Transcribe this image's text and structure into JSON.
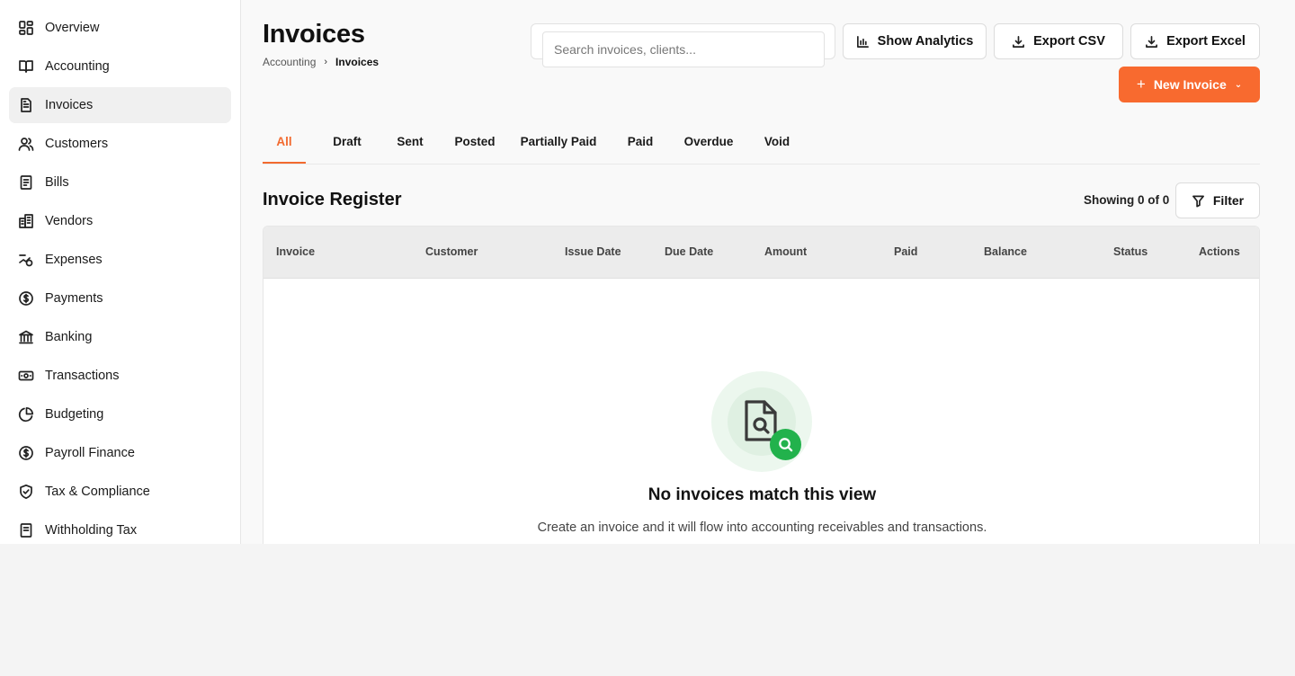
{
  "sidebar": {
    "items": [
      {
        "label": "Overview",
        "icon": "overview-icon"
      },
      {
        "label": "Accounting",
        "icon": "book-icon"
      },
      {
        "label": "Invoices",
        "icon": "invoice-icon",
        "active": true
      },
      {
        "label": "Customers",
        "icon": "users-icon"
      },
      {
        "label": "Bills",
        "icon": "bill-icon"
      },
      {
        "label": "Vendors",
        "icon": "building-icon"
      },
      {
        "label": "Expenses",
        "icon": "expense-icon"
      },
      {
        "label": "Payments",
        "icon": "dollar-icon"
      },
      {
        "label": "Banking",
        "icon": "bank-icon"
      },
      {
        "label": "Transactions",
        "icon": "cash-icon"
      },
      {
        "label": "Budgeting",
        "icon": "pie-icon"
      },
      {
        "label": "Payroll Finance",
        "icon": "dollar-icon"
      },
      {
        "label": "Tax & Compliance",
        "icon": "shield-icon"
      },
      {
        "label": "Withholding Tax",
        "icon": "receipt-icon"
      }
    ]
  },
  "header": {
    "title": "Invoices",
    "breadcrumb": {
      "parent": "Accounting",
      "current": "Invoices"
    },
    "search": {
      "placeholder": "Search invoices, clients...",
      "value": ""
    },
    "actions": {
      "show_analytics": "Show Analytics",
      "export_csv": "Export CSV",
      "export_excel": "Export Excel",
      "new_invoice": "New Invoice"
    }
  },
  "tabs": [
    {
      "label": "All",
      "active": true
    },
    {
      "label": "Draft"
    },
    {
      "label": "Sent"
    },
    {
      "label": "Posted"
    },
    {
      "label": "Partially Paid"
    },
    {
      "label": "Paid"
    },
    {
      "label": "Overdue"
    },
    {
      "label": "Void"
    }
  ],
  "register": {
    "title": "Invoice Register",
    "showing": "Showing 0 of 0",
    "filter_label": "Filter",
    "columns": [
      "Invoice",
      "Customer",
      "Issue Date",
      "Due Date",
      "Amount",
      "Paid",
      "Balance",
      "Status",
      "Actions"
    ],
    "rows": [],
    "empty": {
      "title": "No invoices match this view",
      "subtitle": "Create an invoice and it will flow into accounting receivables and transactions."
    }
  },
  "colors": {
    "accent": "#f86a2f",
    "empty_badge": "#22b24c"
  }
}
